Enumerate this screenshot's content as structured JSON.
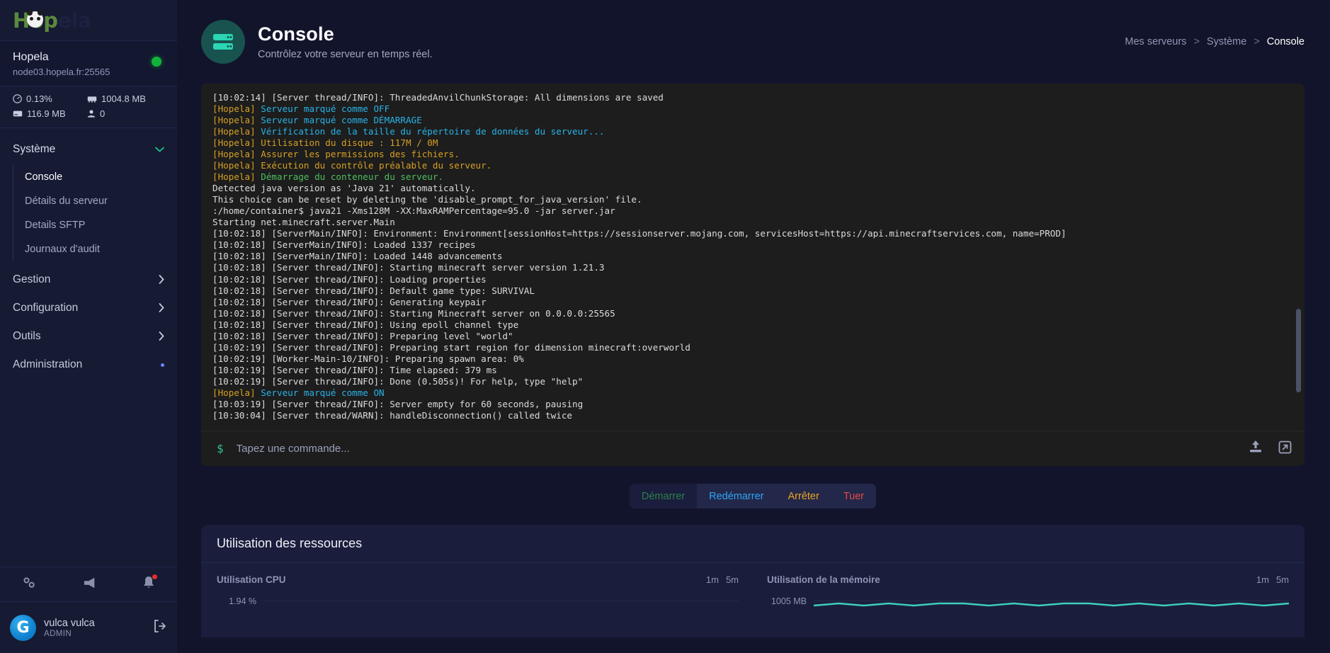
{
  "brand": {
    "name": "Hopela",
    "logo_text": "Hopela"
  },
  "server": {
    "name": "Hopela",
    "address": "node03.hopela.fr:25565",
    "status": "online",
    "status_color": "#12b33a",
    "stats": {
      "cpu": "0.13%",
      "memory": "1004.8 MB",
      "disk": "116.9 MB",
      "players": "0"
    }
  },
  "sidebar": {
    "groups": [
      {
        "label": "Système",
        "expanded": true,
        "items": [
          {
            "label": "Console",
            "selected": true
          },
          {
            "label": "Détails du serveur",
            "selected": false
          },
          {
            "label": "Details SFTP",
            "selected": false
          },
          {
            "label": "Journaux d'audit",
            "selected": false
          }
        ]
      },
      {
        "label": "Gestion",
        "expanded": false,
        "items": []
      },
      {
        "label": "Configuration",
        "expanded": false,
        "items": []
      },
      {
        "label": "Outils",
        "expanded": false,
        "items": []
      },
      {
        "label": "Administration",
        "expanded": false,
        "badge": true,
        "items": []
      }
    ],
    "tools": [
      "settings-icon",
      "megaphone-icon",
      "bell-icon"
    ],
    "user": {
      "name": "vulca vulca",
      "role": "ADMIN",
      "initial": "G"
    }
  },
  "header": {
    "title": "Console",
    "subtitle": "Contrôlez votre serveur en temps réel.",
    "icon": "server-icon",
    "accent": "#2cd5b4"
  },
  "breadcrumb": {
    "items": [
      "Mes serveurs",
      "Système",
      "Console"
    ],
    "separator": ">"
  },
  "console": {
    "lines": [
      {
        "parts": [
          {
            "t": "[10:02:14] [Server thread/INFO]: ThreadedAnvilChunkStorage: All dimensions are saved",
            "c": "l-white"
          }
        ]
      },
      {
        "parts": [
          {
            "t": "[Hopela] ",
            "c": "l-tag"
          },
          {
            "t": "Serveur marqué comme OFF",
            "c": "l-blue"
          }
        ]
      },
      {
        "parts": [
          {
            "t": "[Hopela] ",
            "c": "l-tag"
          },
          {
            "t": "Serveur marqué comme DÉMARRAGE",
            "c": "l-blue"
          }
        ]
      },
      {
        "parts": [
          {
            "t": "[Hopela] ",
            "c": "l-tag"
          },
          {
            "t": "Vérification de la taille du répertoire de données du serveur...",
            "c": "l-blue"
          }
        ]
      },
      {
        "parts": [
          {
            "t": "[Hopela] ",
            "c": "l-tag"
          },
          {
            "t": "Utilisation du disque : 117M / 0M",
            "c": "l-tag"
          }
        ]
      },
      {
        "parts": [
          {
            "t": "[Hopela] ",
            "c": "l-tag"
          },
          {
            "t": "Assurer les permissions des fichiers.",
            "c": "l-tag"
          }
        ]
      },
      {
        "parts": [
          {
            "t": "[Hopela] ",
            "c": "l-tag"
          },
          {
            "t": "Exécution du contrôle préalable du serveur.",
            "c": "l-tag"
          }
        ]
      },
      {
        "parts": [
          {
            "t": "[Hopela] ",
            "c": "l-tag"
          },
          {
            "t": "Démarrage du conteneur du serveur.",
            "c": "l-green"
          }
        ]
      },
      {
        "parts": [
          {
            "t": "Detected java version as 'Java 21' automatically.",
            "c": "l-white"
          }
        ]
      },
      {
        "parts": [
          {
            "t": "This choice can be reset by deleting the 'disable_prompt_for_java_version' file.",
            "c": "l-white"
          }
        ]
      },
      {
        "parts": [
          {
            "t": ":/home/container$ java21 -Xms128M -XX:MaxRAMPercentage=95.0 -jar server.jar",
            "c": "l-white"
          }
        ]
      },
      {
        "parts": [
          {
            "t": "Starting net.minecraft.server.Main",
            "c": "l-white"
          }
        ]
      },
      {
        "parts": [
          {
            "t": "[10:02:18] [ServerMain/INFO]: Environment: Environment[sessionHost=https://sessionserver.mojang.com, servicesHost=https://api.minecraftservices.com, name=PROD]",
            "c": "l-white"
          }
        ]
      },
      {
        "parts": [
          {
            "t": "[10:02:18] [ServerMain/INFO]: Loaded 1337 recipes",
            "c": "l-white"
          }
        ]
      },
      {
        "parts": [
          {
            "t": "[10:02:18] [ServerMain/INFO]: Loaded 1448 advancements",
            "c": "l-white"
          }
        ]
      },
      {
        "parts": [
          {
            "t": "[10:02:18] [Server thread/INFO]: Starting minecraft server version 1.21.3",
            "c": "l-white"
          }
        ]
      },
      {
        "parts": [
          {
            "t": "[10:02:18] [Server thread/INFO]: Loading properties",
            "c": "l-white"
          }
        ]
      },
      {
        "parts": [
          {
            "t": "[10:02:18] [Server thread/INFO]: Default game type: SURVIVAL",
            "c": "l-white"
          }
        ]
      },
      {
        "parts": [
          {
            "t": "[10:02:18] [Server thread/INFO]: Generating keypair",
            "c": "l-white"
          }
        ]
      },
      {
        "parts": [
          {
            "t": "[10:02:18] [Server thread/INFO]: Starting Minecraft server on 0.0.0.0:25565",
            "c": "l-white"
          }
        ]
      },
      {
        "parts": [
          {
            "t": "[10:02:18] [Server thread/INFO]: Using epoll channel type",
            "c": "l-white"
          }
        ]
      },
      {
        "parts": [
          {
            "t": "[10:02:18] [Server thread/INFO]: Preparing level \"world\"",
            "c": "l-white"
          }
        ]
      },
      {
        "parts": [
          {
            "t": "[10:02:19] [Server thread/INFO]: Preparing start region for dimension minecraft:overworld",
            "c": "l-white"
          }
        ]
      },
      {
        "parts": [
          {
            "t": "[10:02:19] [Worker-Main-10/INFO]: Preparing spawn area: 0%",
            "c": "l-white"
          }
        ]
      },
      {
        "parts": [
          {
            "t": "[10:02:19] [Server thread/INFO]: Time elapsed: 379 ms",
            "c": "l-white"
          }
        ]
      },
      {
        "parts": [
          {
            "t": "[10:02:19] [Server thread/INFO]: Done (0.505s)! For help, type \"help\"",
            "c": "l-white"
          }
        ]
      },
      {
        "parts": [
          {
            "t": "[Hopela] ",
            "c": "l-tag"
          },
          {
            "t": "Serveur marqué comme ON",
            "c": "l-blue"
          }
        ]
      },
      {
        "parts": [
          {
            "t": "[10:03:19] [Server thread/INFO]: Server empty for 60 seconds, pausing",
            "c": "l-white"
          }
        ]
      },
      {
        "parts": [
          {
            "t": "[10:30:04] [Server thread/WARN]: handleDisconnection() called twice",
            "c": "l-white"
          }
        ]
      }
    ]
  },
  "command": {
    "prompt": "$",
    "placeholder": "Tapez une commande...",
    "value": "",
    "icons": [
      "upload-icon",
      "expand-icon"
    ]
  },
  "power": {
    "buttons": [
      {
        "label": "Démarrer",
        "state": "disabled",
        "color": "#2f7f4b"
      },
      {
        "label": "Redémarrer",
        "state": "enabled",
        "color": "#30a5f5"
      },
      {
        "label": "Arrêter",
        "state": "enabled",
        "color": "#e9a522"
      },
      {
        "label": "Tuer",
        "state": "enabled",
        "color": "#e84a4a"
      }
    ]
  },
  "resources": {
    "title": "Utilisation des ressources",
    "ranges": [
      "1m",
      "5m"
    ]
  },
  "chart_data": [
    {
      "type": "line",
      "title": "Utilisation CPU",
      "ylabel": "1.94 %",
      "xlabel": "",
      "ranges": [
        "1m",
        "5m"
      ],
      "selected_range": "1m",
      "ylim": [
        0,
        1.94
      ],
      "x": [
        0,
        1,
        2,
        3,
        4,
        5,
        6,
        7,
        8,
        9,
        10,
        11,
        12,
        13,
        14,
        15,
        16,
        17,
        18,
        19
      ],
      "values": [
        0,
        0,
        0,
        0,
        0,
        0,
        0,
        0,
        0,
        0,
        0,
        0,
        0,
        0,
        0,
        0,
        0,
        0,
        0,
        0
      ],
      "series": [
        {
          "name": "CPU",
          "values": [
            0,
            0,
            0,
            0,
            0,
            0,
            0,
            0,
            0,
            0,
            0,
            0,
            0,
            0,
            0,
            0,
            0,
            0,
            0,
            0
          ],
          "color": "#2cd5b4"
        }
      ],
      "grid": true,
      "legend": "none"
    },
    {
      "type": "line",
      "title": "Utilisation de la mémoire",
      "ylabel": "1005 MB",
      "xlabel": "",
      "ranges": [
        "1m",
        "5m"
      ],
      "selected_range": "1m",
      "ylim": [
        0,
        1005
      ],
      "x": [
        0,
        1,
        2,
        3,
        4,
        5,
        6,
        7,
        8,
        9,
        10,
        11,
        12,
        13,
        14,
        15,
        16,
        17,
        18,
        19
      ],
      "values": [
        1004,
        1005,
        1004,
        1005,
        1004,
        1005,
        1005,
        1004,
        1005,
        1004,
        1005,
        1005,
        1004,
        1005,
        1004,
        1005,
        1004,
        1005,
        1004,
        1005
      ],
      "series": [
        {
          "name": "Mémoire",
          "values": [
            1004,
            1005,
            1004,
            1005,
            1004,
            1005,
            1005,
            1004,
            1005,
            1004,
            1005,
            1005,
            1004,
            1005,
            1004,
            1005,
            1004,
            1005,
            1004,
            1005
          ],
          "color": "#3ccfbb"
        }
      ],
      "grid": true,
      "legend": "none"
    }
  ]
}
